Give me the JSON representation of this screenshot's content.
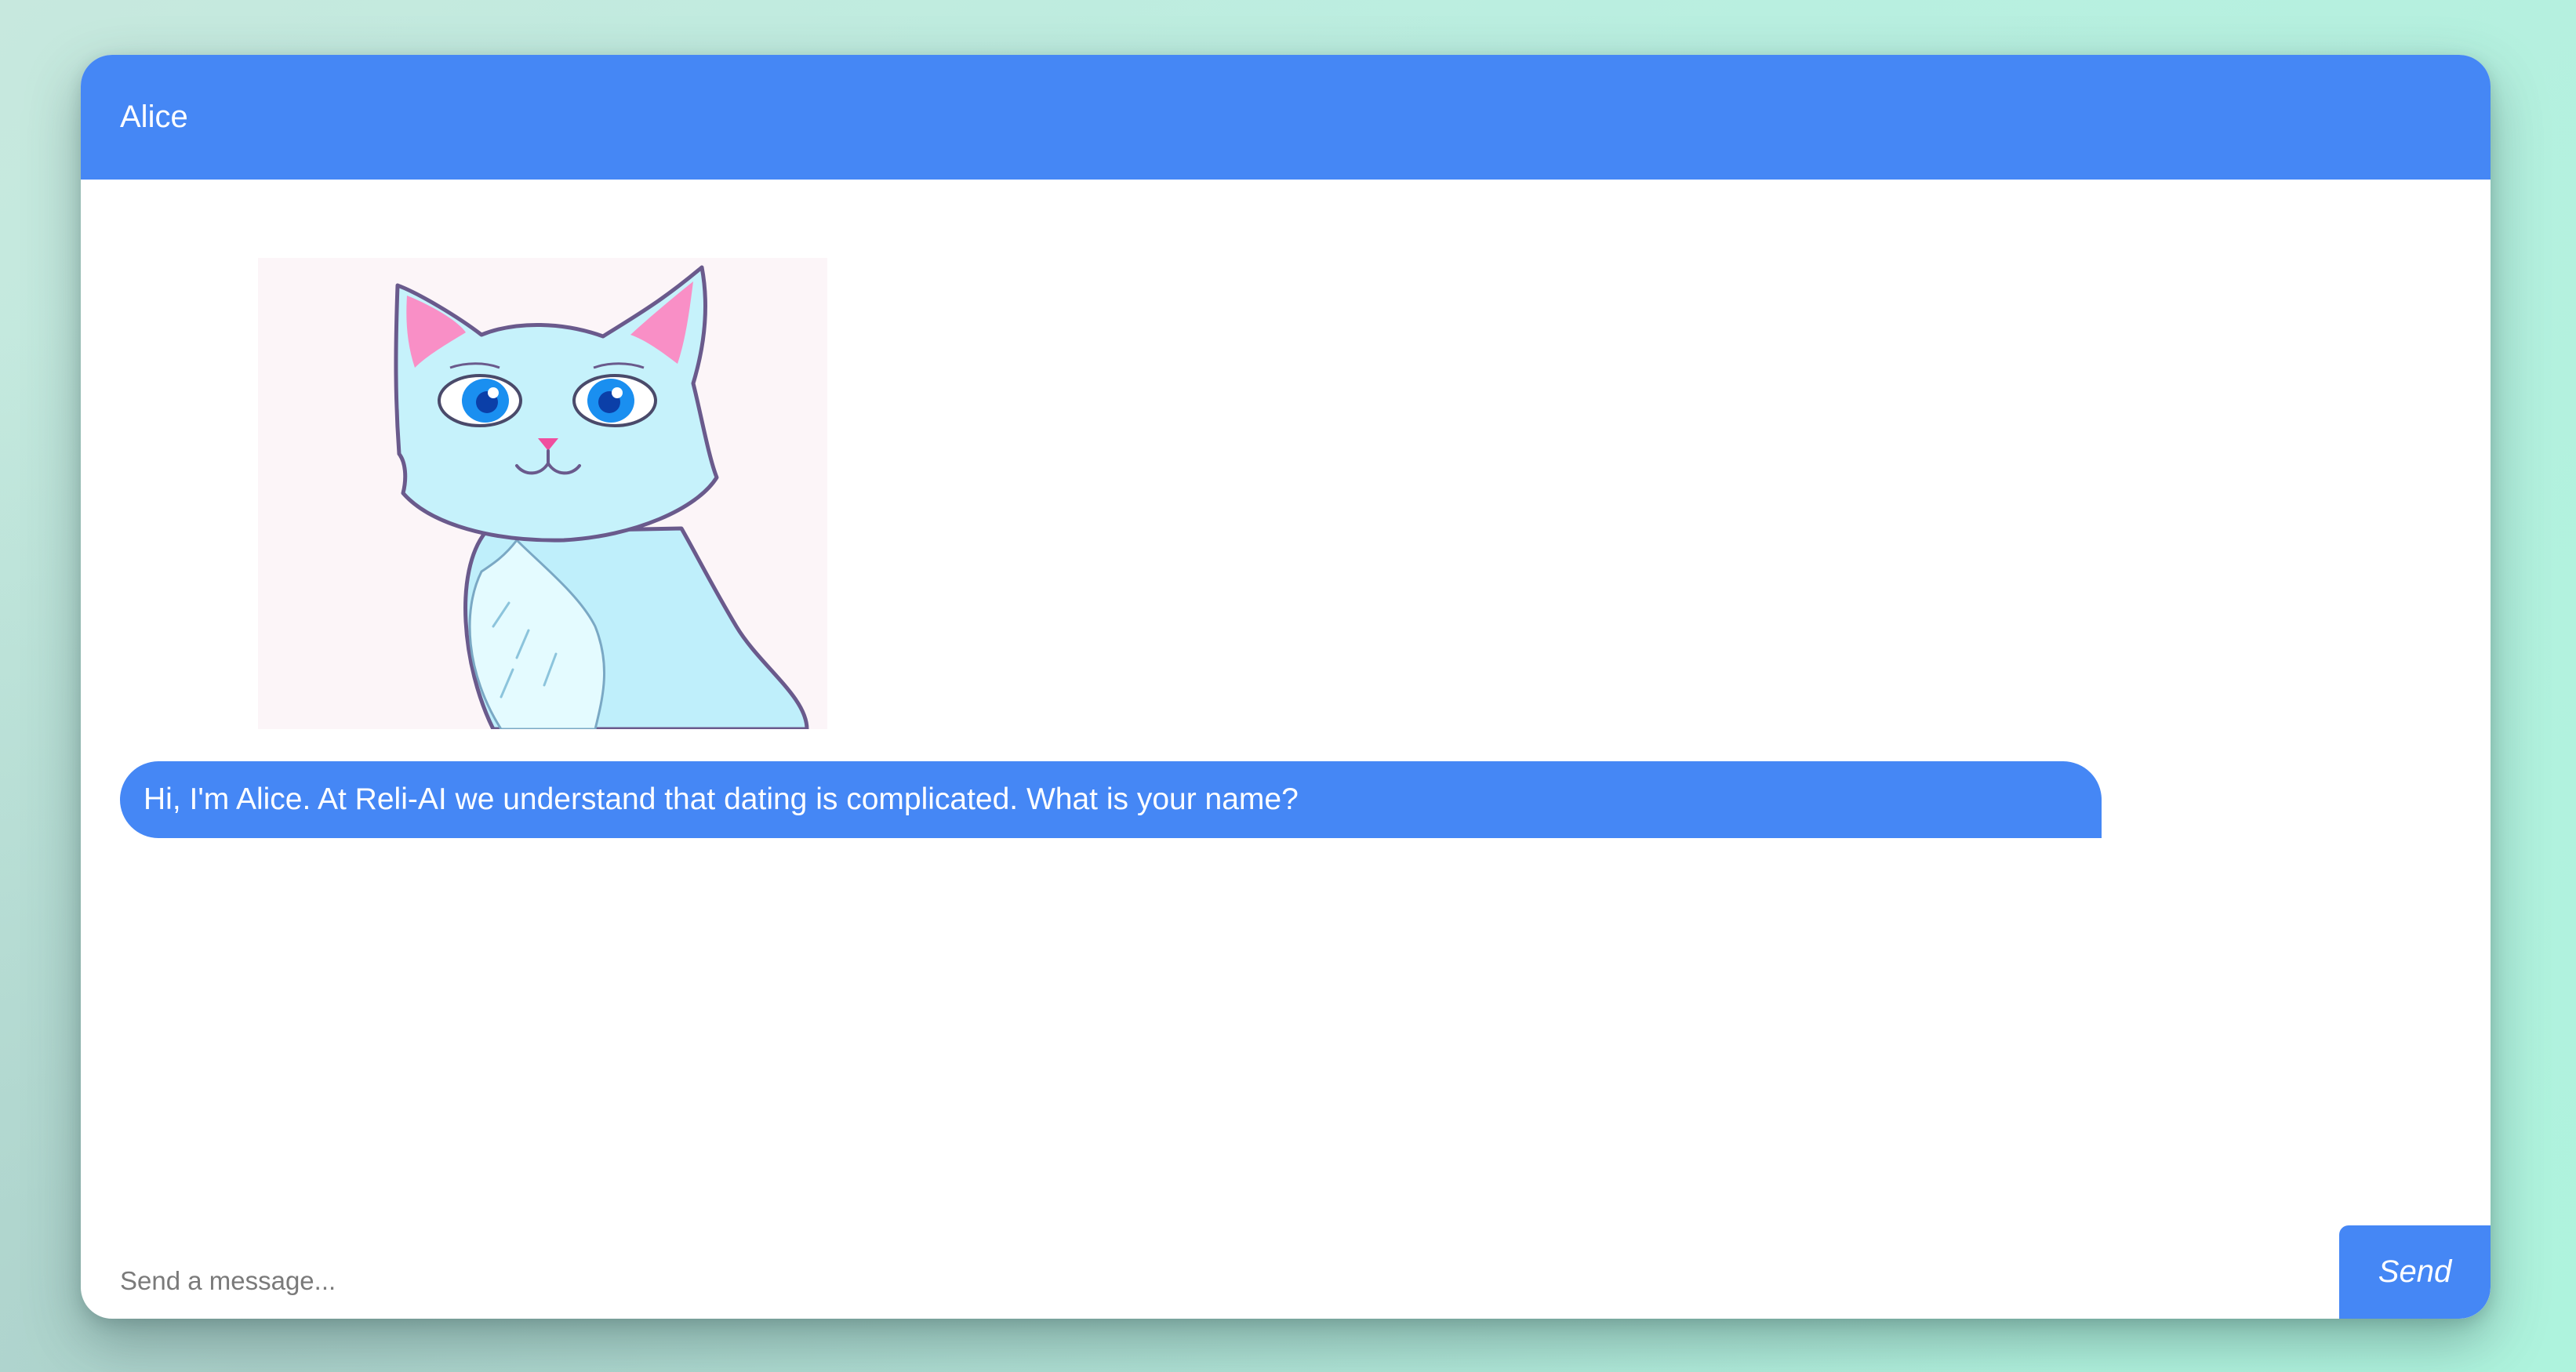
{
  "header": {
    "title": "Alice"
  },
  "messages": [
    {
      "sender": "Alice",
      "avatar": "cat-avatar-icon",
      "text": "Hi, I'm Alice. At Reli-AI we understand that dating is complicated. What is your name?"
    }
  ],
  "composer": {
    "placeholder": "Send a message...",
    "value": "",
    "send_label": "Send"
  },
  "colors": {
    "accent": "#4587f5",
    "window_background": "#ffffff",
    "page_gradient_start": "#c7e8de",
    "page_gradient_end": "#aef3dd"
  }
}
